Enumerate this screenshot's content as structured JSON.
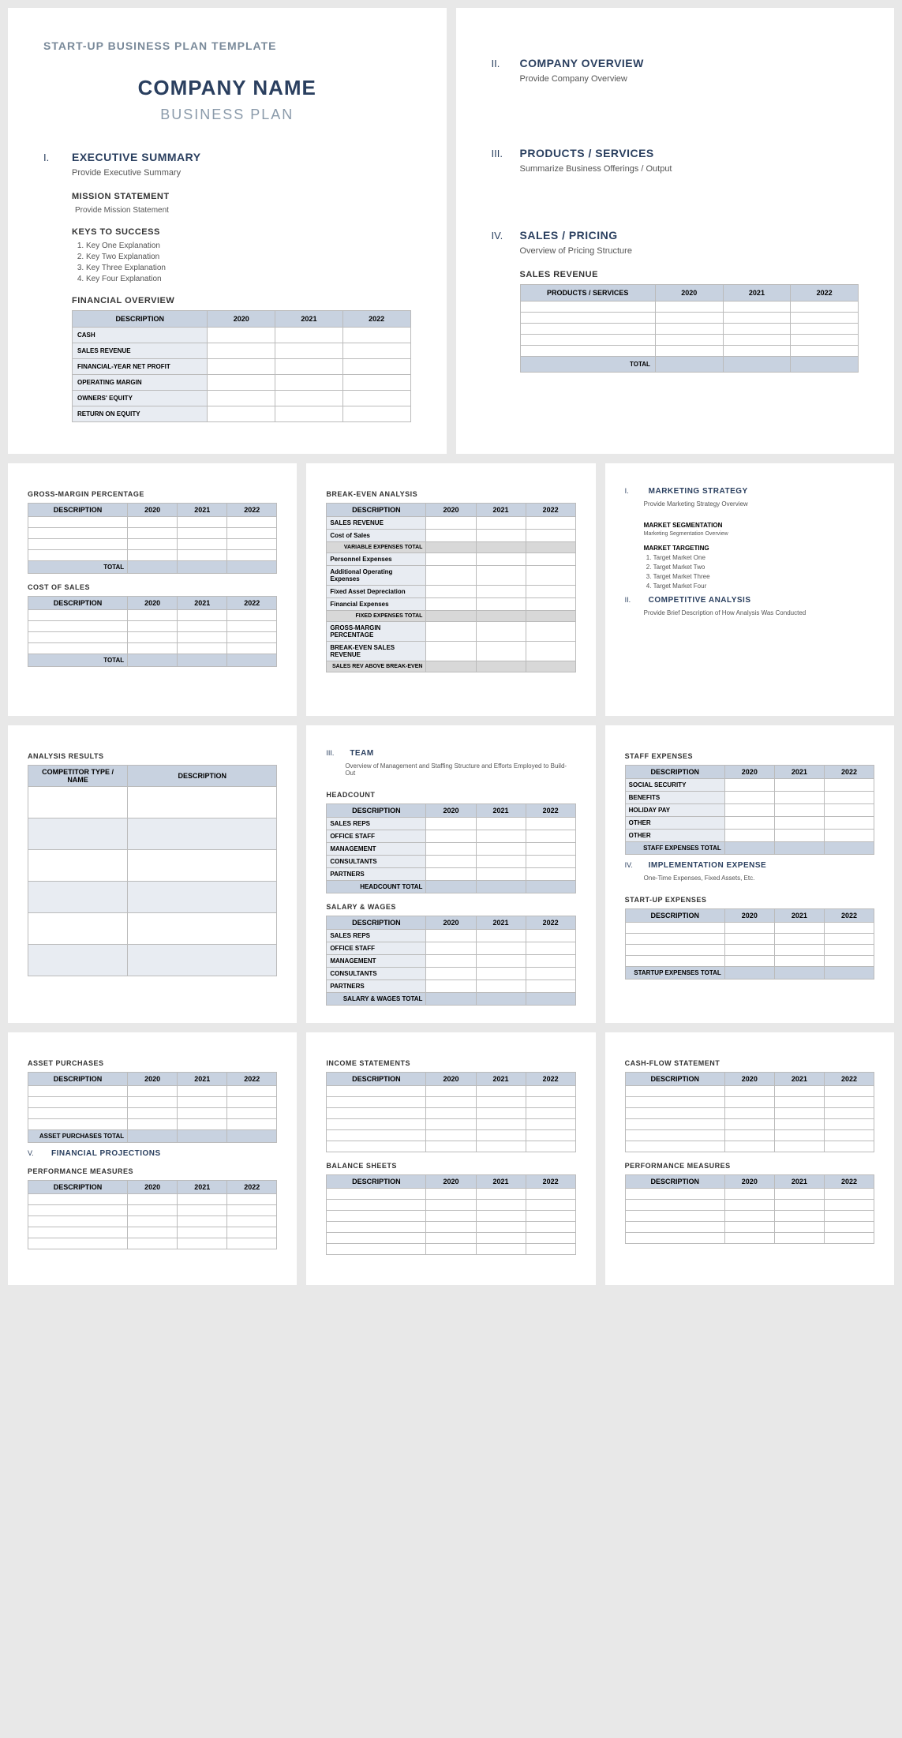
{
  "template_header": "START-UP BUSINESS PLAN TEMPLATE",
  "company_name": "COMPANY NAME",
  "business_plan": "BUSINESS PLAN",
  "p1": {
    "s1": {
      "num": "I.",
      "title": "EXECUTIVE SUMMARY",
      "body": "Provide Executive Summary"
    },
    "mission": {
      "title": "MISSION STATEMENT",
      "body": "Provide Mission Statement"
    },
    "keys": {
      "title": "KEYS TO SUCCESS",
      "items": [
        "Key One Explanation",
        "Key Two Explanation",
        "Key Three Explanation",
        "Key Four Explanation"
      ]
    },
    "finover": {
      "title": "FINANCIAL OVERVIEW",
      "cols": [
        "DESCRIPTION",
        "2020",
        "2021",
        "2022"
      ],
      "rows": [
        "CASH",
        "SALES REVENUE",
        "FINANCIAL-YEAR NET PROFIT",
        "OPERATING MARGIN",
        "OWNERS' EQUITY",
        "RETURN ON EQUITY"
      ]
    }
  },
  "p2": {
    "s2": {
      "num": "II.",
      "title": "COMPANY OVERVIEW",
      "body": "Provide Company Overview"
    },
    "s3": {
      "num": "III.",
      "title": "PRODUCTS / SERVICES",
      "body": "Summarize Business Offerings / Output"
    },
    "s4": {
      "num": "IV.",
      "title": "SALES / PRICING",
      "body": "Overview of Pricing Structure"
    },
    "salesrev": {
      "title": "SALES REVENUE",
      "cols": [
        "PRODUCTS / SERVICES",
        "2020",
        "2021",
        "2022"
      ],
      "total": "TOTAL"
    }
  },
  "p3": {
    "gross": {
      "title": "GROSS-MARGIN PERCENTAGE",
      "cols": [
        "DESCRIPTION",
        "2020",
        "2021",
        "2022"
      ],
      "total": "TOTAL"
    },
    "cost": {
      "title": "COST OF SALES",
      "cols": [
        "DESCRIPTION",
        "2020",
        "2021",
        "2022"
      ],
      "total": "TOTAL"
    }
  },
  "p4": {
    "break": {
      "title": "BREAK-EVEN ANALYSIS",
      "cols": [
        "DESCRIPTION",
        "2020",
        "2021",
        "2022"
      ],
      "rows": [
        "SALES REVENUE",
        "Cost of Sales",
        "VARIABLE EXPENSES TOTAL",
        "Personnel Expenses",
        "Additional Operating Expenses",
        "Fixed Asset Depreciation",
        "Financial Expenses",
        "FIXED EXPENSES TOTAL",
        "GROSS-MARGIN PERCENTAGE",
        "BREAK-EVEN SALES REVENUE",
        "SALES REV ABOVE BREAK-EVEN"
      ]
    }
  },
  "p5": {
    "s1": {
      "num": "I.",
      "title": "MARKETING STRATEGY",
      "body": "Provide Marketing Strategy Overview"
    },
    "seg": {
      "title": "MARKET SEGMENTATION",
      "body": "Marketing Segmentation Overview"
    },
    "targ": {
      "title": "MARKET TARGETING",
      "items": [
        "Target Market One",
        "Target Market Two",
        "Target Market Three",
        "Target Market Four"
      ]
    },
    "s2": {
      "num": "II.",
      "title": "COMPETITIVE ANALYSIS",
      "body": "Provide Brief Description of How Analysis Was Conducted"
    }
  },
  "p6": {
    "results": {
      "title": "ANALYSIS RESULTS",
      "cols": [
        "COMPETITOR TYPE / NAME",
        "DESCRIPTION"
      ]
    }
  },
  "p7": {
    "s3": {
      "num": "III.",
      "title": "TEAM",
      "body": "Overview of Management and Staffing Structure and Efforts Employed to Build-Out"
    },
    "headcount": {
      "title": "HEADCOUNT",
      "cols": [
        "DESCRIPTION",
        "2020",
        "2021",
        "2022"
      ],
      "rows": [
        "SALES REPS",
        "OFFICE STAFF",
        "MANAGEMENT",
        "CONSULTANTS",
        "PARTNERS"
      ],
      "total": "HEADCOUNT TOTAL"
    },
    "salary": {
      "title": "SALARY & WAGES",
      "cols": [
        "DESCRIPTION",
        "2020",
        "2021",
        "2022"
      ],
      "rows": [
        "SALES REPS",
        "OFFICE STAFF",
        "MANAGEMENT",
        "CONSULTANTS",
        "PARTNERS"
      ],
      "total": "SALARY & WAGES TOTAL"
    }
  },
  "p8": {
    "staff": {
      "title": "STAFF EXPENSES",
      "cols": [
        "DESCRIPTION",
        "2020",
        "2021",
        "2022"
      ],
      "rows": [
        "SOCIAL SECURITY",
        "BENEFITS",
        "HOLIDAY PAY",
        "OTHER",
        "OTHER"
      ],
      "total": "STAFF EXPENSES TOTAL"
    },
    "s4": {
      "num": "IV.",
      "title": "IMPLEMENTATION EXPENSE",
      "body": "One-Time Expenses, Fixed Assets, Etc."
    },
    "startup": {
      "title": "START-UP EXPENSES",
      "cols": [
        "DESCRIPTION",
        "2020",
        "2021",
        "2022"
      ],
      "total": "STARTUP EXPENSES TOTAL"
    }
  },
  "p9": {
    "asset": {
      "title": "ASSET PURCHASES",
      "cols": [
        "DESCRIPTION",
        "2020",
        "2021",
        "2022"
      ],
      "total": "ASSET PURCHASES TOTAL"
    },
    "s5": {
      "num": "V.",
      "title": "FINANCIAL PROJECTIONS"
    },
    "perf": {
      "title": "PERFORMANCE MEASURES",
      "cols": [
        "DESCRIPTION",
        "2020",
        "2021",
        "2022"
      ]
    }
  },
  "p10": {
    "income": {
      "title": "INCOME STATEMENTS",
      "cols": [
        "DESCRIPTION",
        "2020",
        "2021",
        "2022"
      ]
    },
    "balance": {
      "title": "BALANCE SHEETS",
      "cols": [
        "DESCRIPTION",
        "2020",
        "2021",
        "2022"
      ]
    }
  },
  "p11": {
    "cash": {
      "title": "CASH-FLOW STATEMENT",
      "cols": [
        "DESCRIPTION",
        "2020",
        "2021",
        "2022"
      ]
    },
    "perf": {
      "title": "PERFORMANCE MEASURES",
      "cols": [
        "DESCRIPTION",
        "2020",
        "2021",
        "2022"
      ]
    }
  }
}
